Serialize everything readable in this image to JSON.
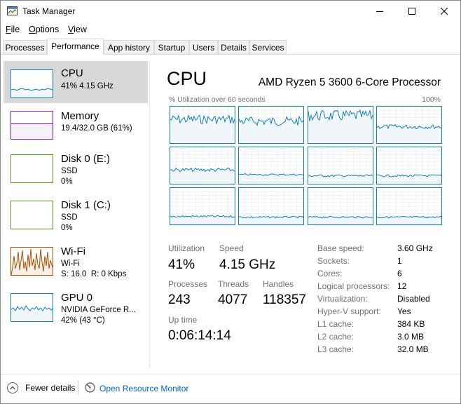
{
  "window": {
    "title": "Task Manager"
  },
  "menu": [
    {
      "label": "File",
      "underline": "F",
      "rest": "ile"
    },
    {
      "label": "Options",
      "underline": "O",
      "rest": "ptions"
    },
    {
      "label": "View",
      "underline": "V",
      "rest": "iew"
    }
  ],
  "tabs": [
    "Processes",
    "Performance",
    "App history",
    "Startup",
    "Users",
    "Details",
    "Services"
  ],
  "active_tab": "Performance",
  "sidebar": {
    "cpu": {
      "name": "CPU",
      "detail": "41% 4.15 GHz"
    },
    "memory": {
      "name": "Memory",
      "detail": "19.4/32.0 GB (61%)"
    },
    "disk0": {
      "name": "Disk 0 (E:)",
      "type": "SSD",
      "usage": "0%"
    },
    "disk1": {
      "name": "Disk 1 (C:)",
      "type": "SSD",
      "usage": "0%"
    },
    "wifi": {
      "name": "Wi-Fi",
      "adapter": "Wi-Fi",
      "throughput": "S: 16.0  R: 0 Kbps"
    },
    "gpu": {
      "name": "GPU 0",
      "model": "NVIDIA GeForce R...",
      "usage": "42% (43 °C)"
    }
  },
  "cpu": {
    "title": "CPU",
    "model": "AMD Ryzen 5 3600 6-Core Processor",
    "graph_label": "% Utilization over 60 seconds",
    "graph_max": "100%",
    "utilization_label": "Utilization",
    "utilization": "41%",
    "speed_label": "Speed",
    "speed": "4.15 GHz",
    "processes_label": "Processes",
    "processes": "243",
    "threads_label": "Threads",
    "threads": "4077",
    "handles_label": "Handles",
    "handles": "118357",
    "uptime_label": "Up time",
    "uptime": "0:06:14:14",
    "specs": [
      {
        "label": "Base speed:",
        "value": "3.60 GHz"
      },
      {
        "label": "Sockets:",
        "value": "1"
      },
      {
        "label": "Cores:",
        "value": "6"
      },
      {
        "label": "Logical processors:",
        "value": "12"
      },
      {
        "label": "Virtualization:",
        "value": "Disabled"
      },
      {
        "label": "Hyper-V support:",
        "value": "Yes"
      },
      {
        "label": "L1 cache:",
        "value": "384 KB"
      },
      {
        "label": "L2 cache:",
        "value": "3.0 MB"
      },
      {
        "label": "L3 cache:",
        "value": "32.0 MB"
      }
    ]
  },
  "footer": {
    "fewer_details": "Fewer details",
    "fewer_underline": "d",
    "open_resource_monitor": "Open Resource Monitor"
  },
  "colors": {
    "cpu_line": "#117dbb",
    "cpu_fill": "#f1f6fa",
    "memory": "#8b12ae",
    "disk": "#4da60c",
    "wifi": "#a74f01",
    "gpu": "#117dbb",
    "selected_bg": "#d8d8d8",
    "link": "#0066cc"
  }
}
